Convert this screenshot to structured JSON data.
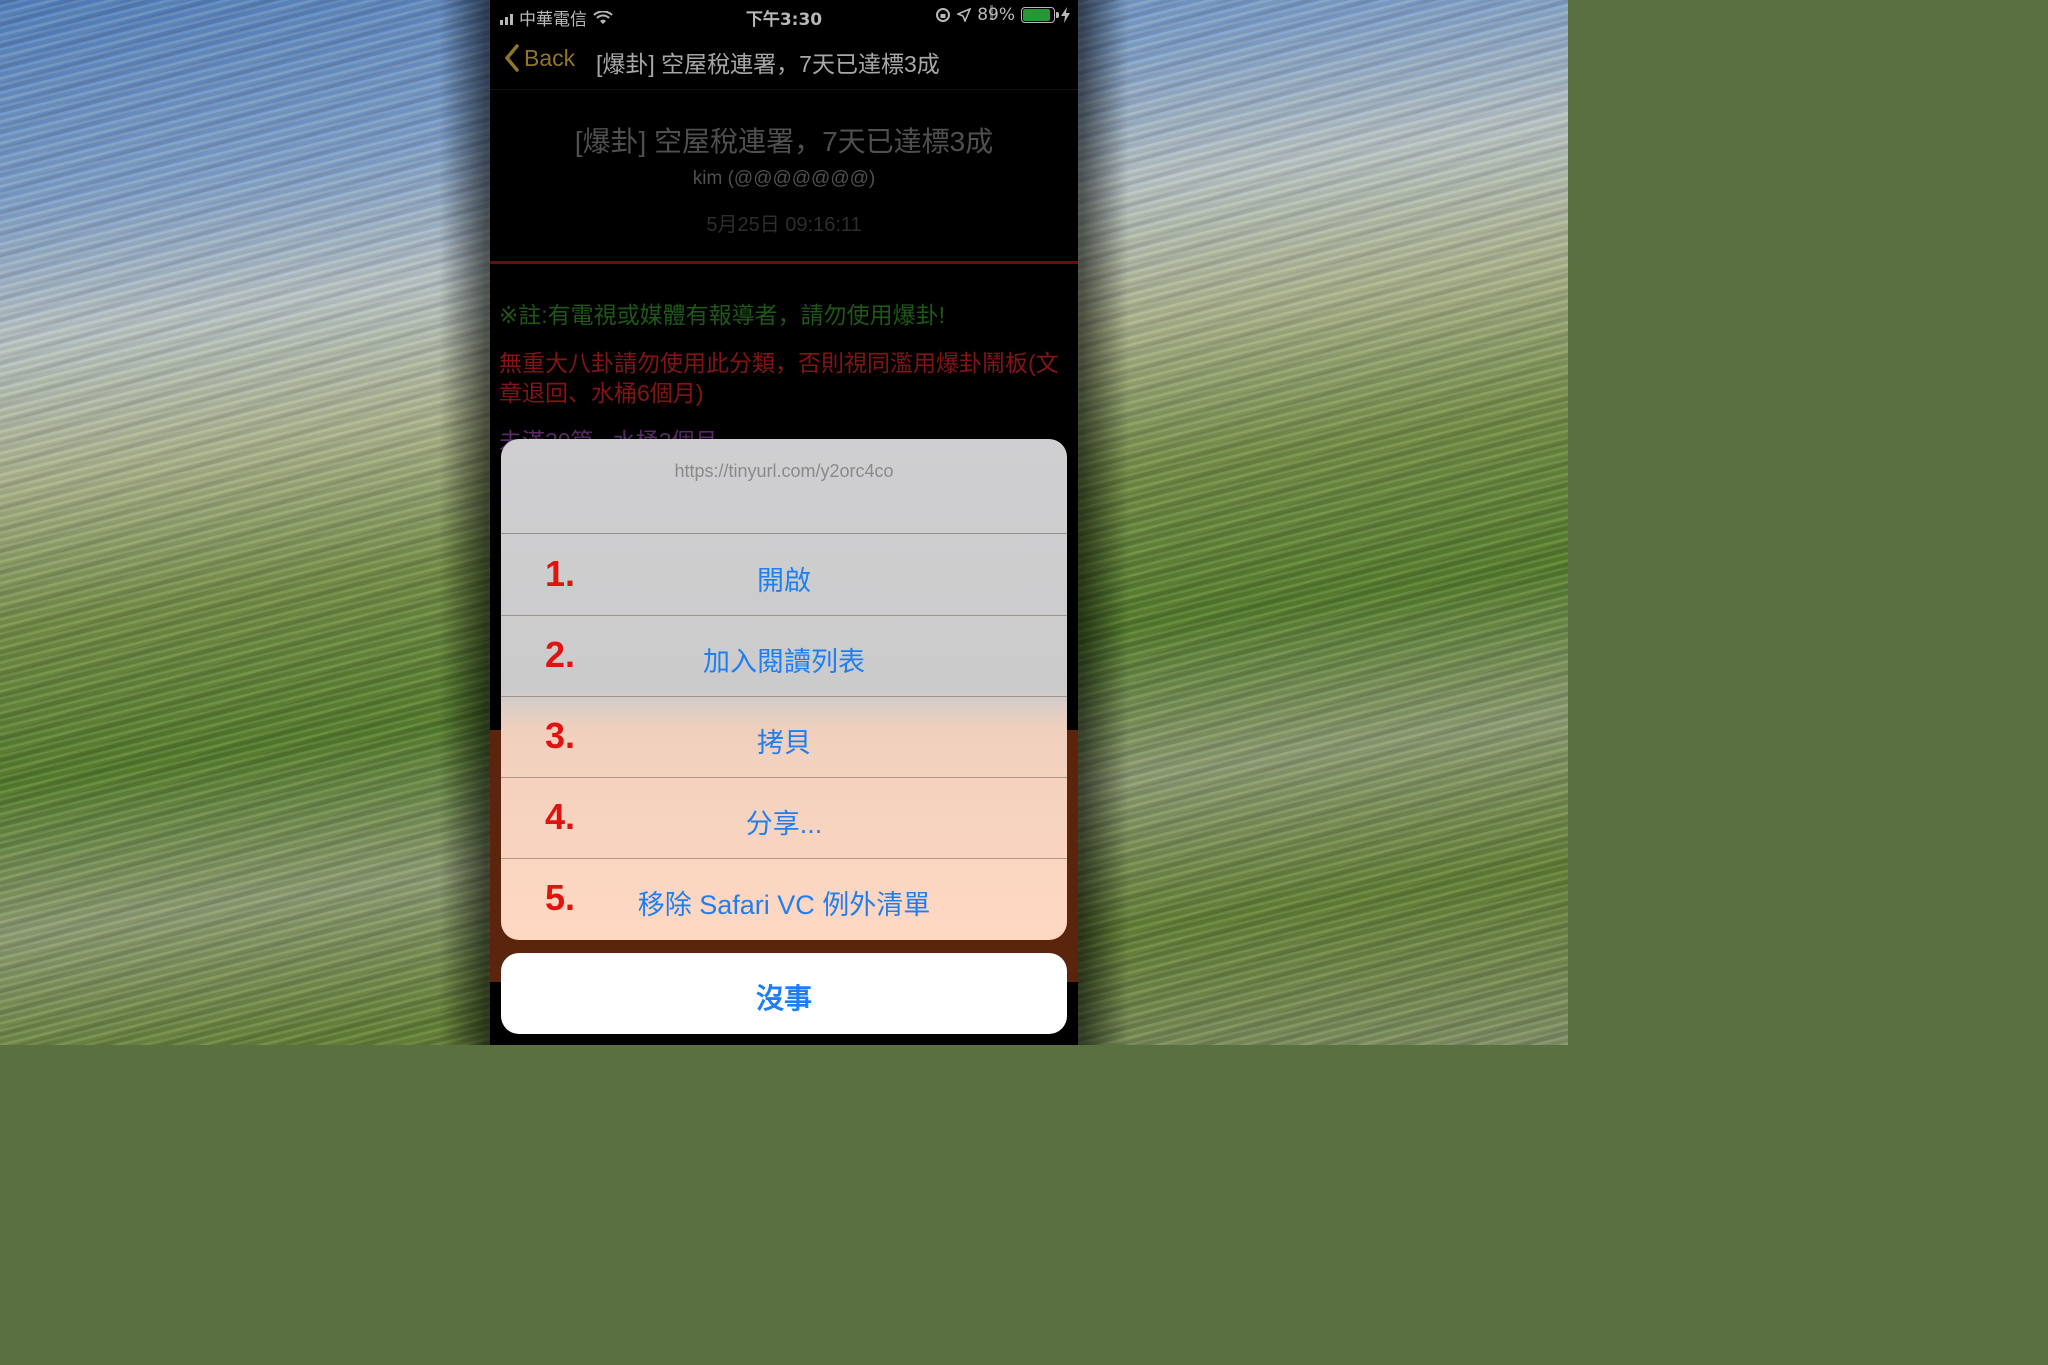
{
  "status_bar": {
    "carrier": "中華電信",
    "time": "下午3:30",
    "battery_percent": "89%",
    "battery_level": 0.89,
    "icons": [
      "signal-icon",
      "wifi-icon",
      "orientation-lock-icon",
      "location-icon",
      "battery-icon",
      "charging-icon"
    ]
  },
  "nav": {
    "back_label": "Back",
    "title": "[爆卦] 空屋稅連署，7天已達標3成"
  },
  "article": {
    "title": "[爆卦] 空屋稅連署，7天已達標3成",
    "author": "kim (@@@@@@@)",
    "date": "5月25日 09:16:11",
    "note": "※註:有電視或媒體有報導者，請勿使用爆卦!",
    "warning": "無重大八卦請勿使用此分類，否則視同濫用爆卦鬧板(文章退回、水桶6個月)",
    "partial_line": "未滿30篇...水桶3個月"
  },
  "action_sheet": {
    "url": "https://tinyurl.com/y2orc4co",
    "items": [
      {
        "number": "1.",
        "label": "開啟"
      },
      {
        "number": "2.",
        "label": "加入閱讀列表"
      },
      {
        "number": "3.",
        "label": "拷貝"
      },
      {
        "number": "4.",
        "label": "分享..."
      },
      {
        "number": "5.",
        "label": "移除 Safari VC 例外清單"
      }
    ],
    "cancel_label": "沒事"
  },
  "colors": {
    "accent_gold": "#c9a33a",
    "ios_blue": "#1f7ff2",
    "annotation_red": "#e0140f",
    "note_green": "#2a7a1f",
    "warning_red": "#b81d1d"
  }
}
